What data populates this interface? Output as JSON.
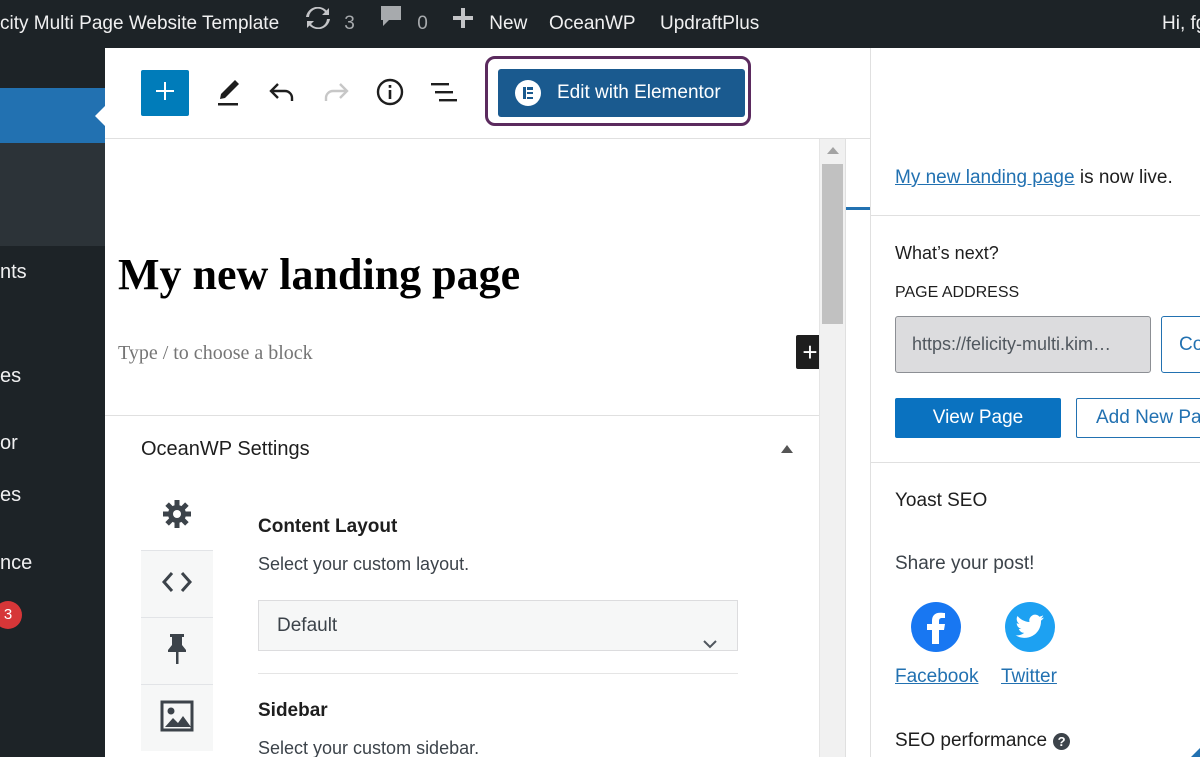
{
  "admin_bar": {
    "site_name": "city Multi Page Website Template",
    "updates_count": "3",
    "comments_count": "0",
    "new_label": "New",
    "oceanwp_label": "OceanWP",
    "updraft_label": "UpdraftPlus",
    "greeting": "Hi, fg"
  },
  "admin_menu": {
    "items": [
      "nts",
      "es",
      "or",
      "es",
      "nce"
    ],
    "badge_count": "3"
  },
  "toolbar": {
    "elementor_label": "Edit with Elementor"
  },
  "canvas": {
    "title": "My new landing page",
    "block_placeholder": "Type / to choose a block",
    "block_plus": "+"
  },
  "oceanwp": {
    "title": "OceanWP Settings",
    "content_layout_label": "Content Layout",
    "content_layout_desc": "Select your custom layout.",
    "content_layout_value": "Default",
    "sidebar_label": "Sidebar",
    "sidebar_desc": "Select your custom sidebar."
  },
  "publish_panel": {
    "page_link": "My new landing page",
    "live_suffix": " is now live.",
    "whats_next": "What’s next?",
    "page_address_label": "PAGE ADDRESS",
    "page_address_value": "https://felicity-multi.kim…",
    "copy_label": "Co",
    "view_page_label": "View Page",
    "add_new_label": "Add New Pa",
    "yoast_title": "Yoast SEO",
    "share_label": "Share your post!",
    "facebook_label": "Facebook",
    "twitter_label": "Twitter",
    "seo_performance_label": "SEO performance",
    "help_glyph": "?"
  },
  "colors": {
    "admin_dark": "#1d2327",
    "wp_blue": "#2271b1",
    "inserter_blue": "#007cba",
    "elementor_blue": "#1a5a8f",
    "facebook_blue": "#1877f2",
    "twitter_blue": "#1da1f2",
    "badge_red": "#d63638"
  }
}
